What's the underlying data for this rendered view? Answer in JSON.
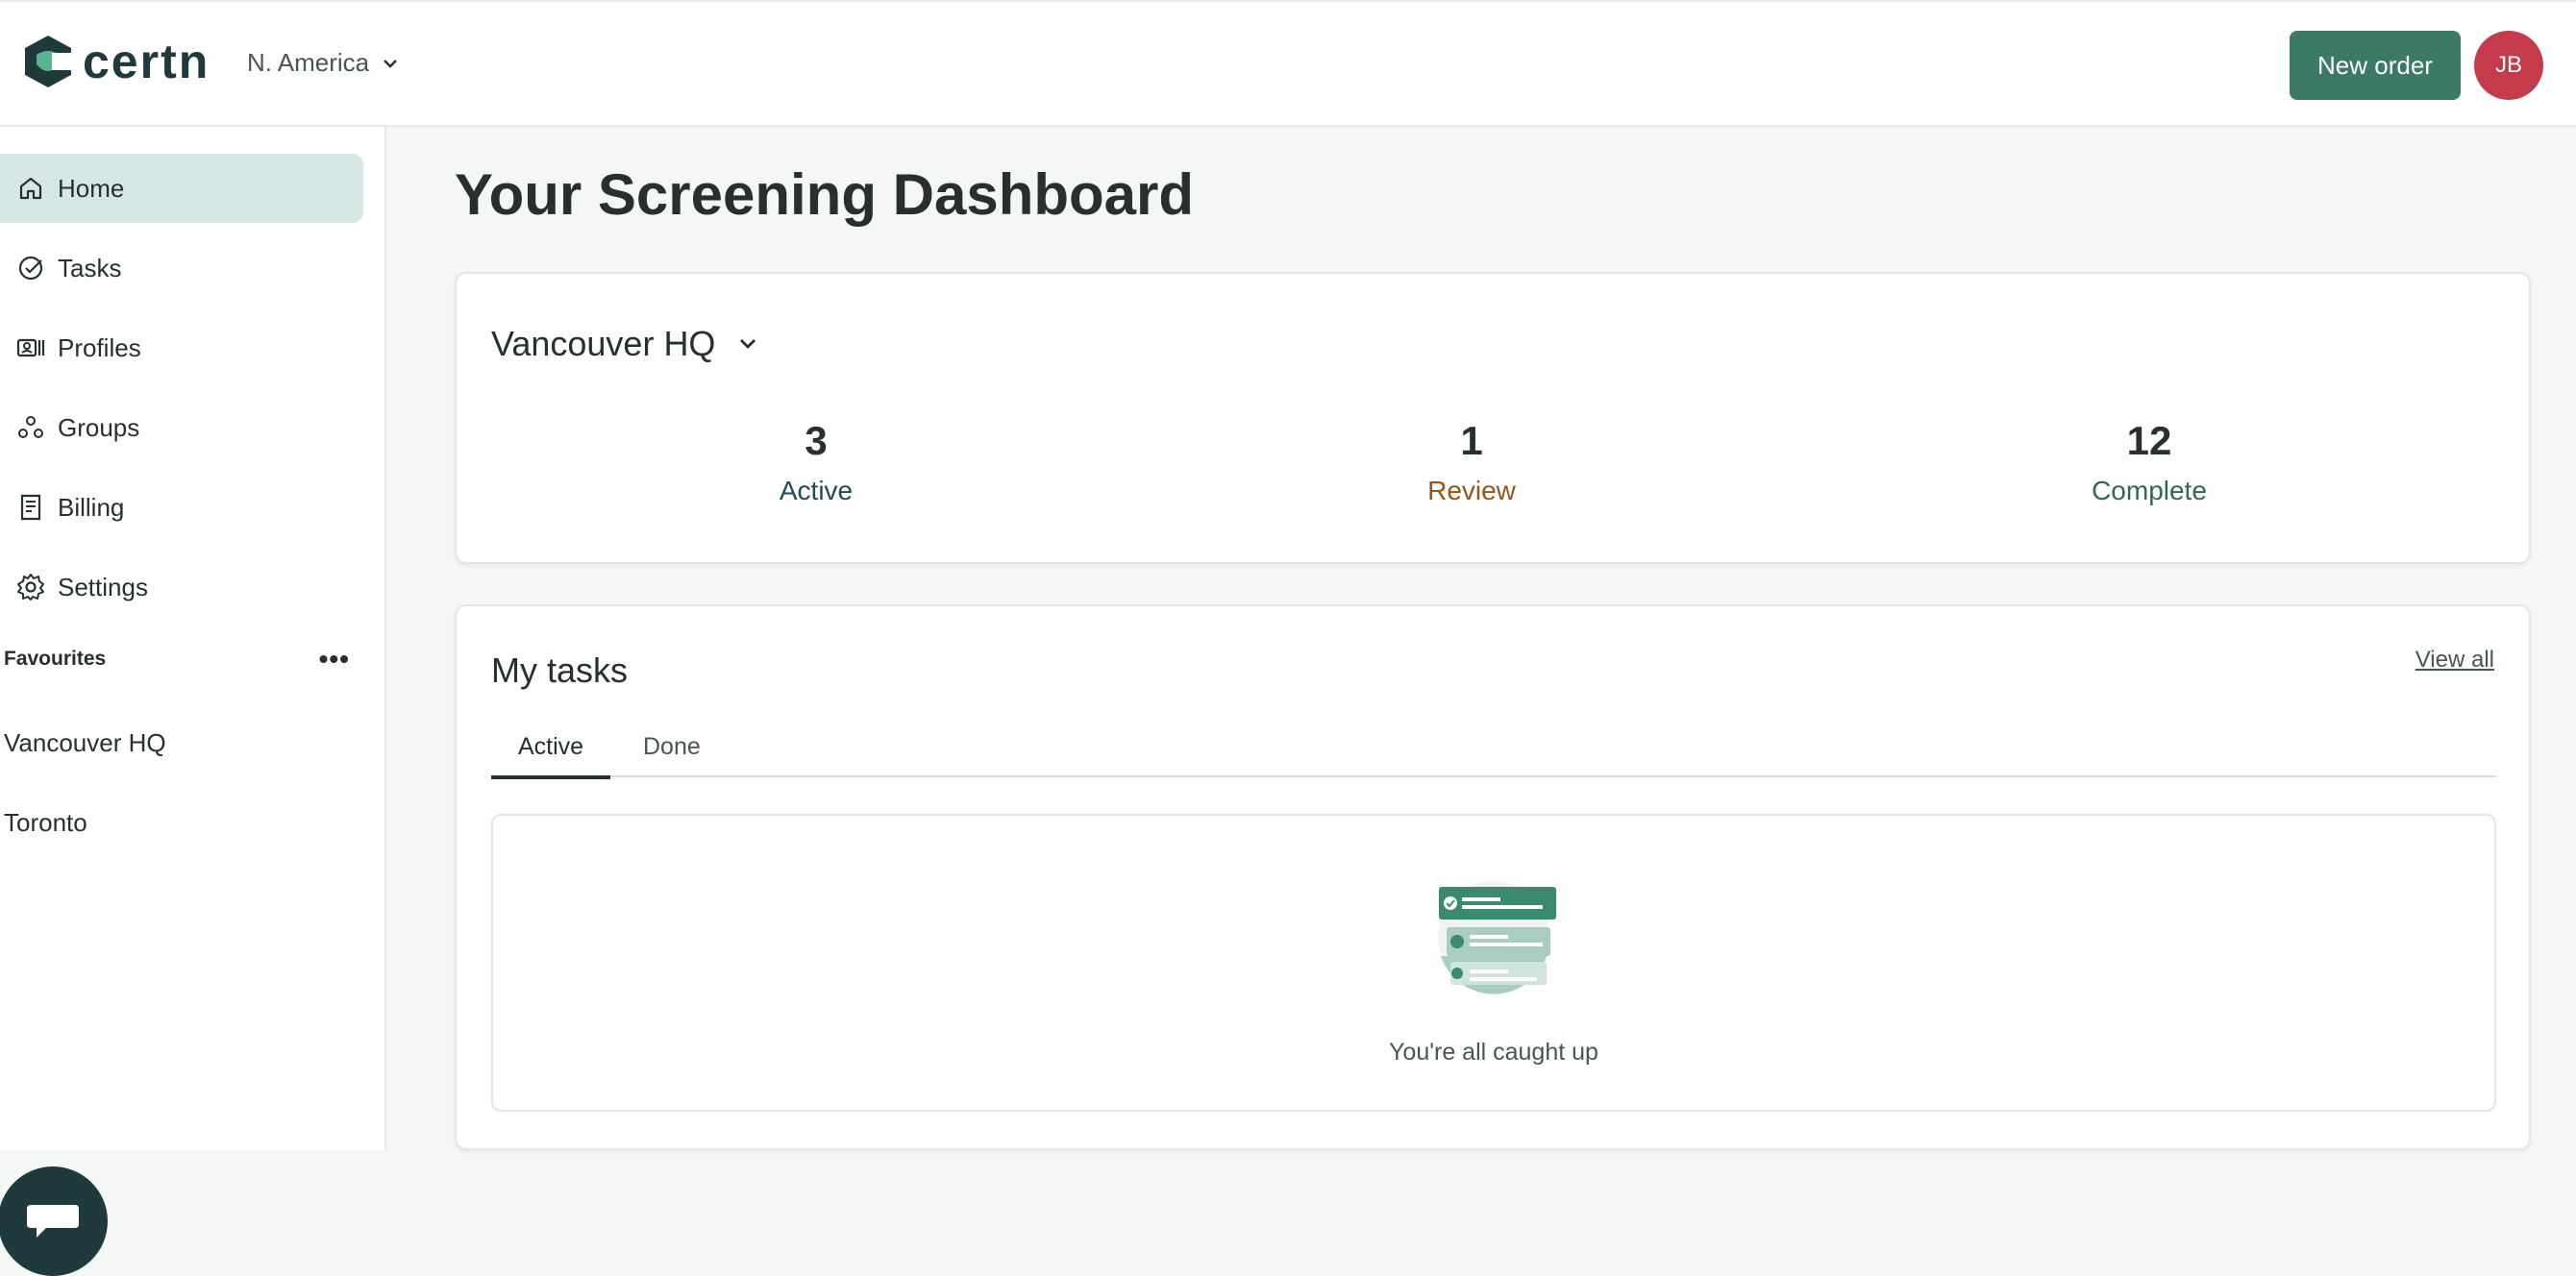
{
  "header": {
    "brand": "certn",
    "region": "N. America",
    "new_order_label": "New order",
    "avatar_initials": "JB",
    "colors": {
      "brand": "#1f3a3d",
      "accent": "#3a7a66",
      "avatar": "#c43c4c"
    }
  },
  "sidebar": {
    "items": [
      {
        "label": "Home",
        "icon": "home-icon"
      },
      {
        "label": "Tasks",
        "icon": "check-circle-icon"
      },
      {
        "label": "Profiles",
        "icon": "profile-card-icon"
      },
      {
        "label": "Groups",
        "icon": "groups-icon"
      },
      {
        "label": "Billing",
        "icon": "receipt-icon"
      },
      {
        "label": "Settings",
        "icon": "gear-icon"
      }
    ],
    "favourites_heading": "Favourites",
    "favourites_more": "•••",
    "favourites": [
      "Vancouver HQ",
      "Toronto"
    ]
  },
  "main": {
    "title": "Your Screening Dashboard",
    "summary": {
      "location": "Vancouver HQ",
      "stats": [
        {
          "value": "3",
          "label": "Active",
          "color": "#1f4b5a"
        },
        {
          "value": "1",
          "label": "Review",
          "color": "#9a5418"
        },
        {
          "value": "12",
          "label": "Complete",
          "color": "#2d6a4f"
        }
      ]
    },
    "tasks": {
      "title": "My tasks",
      "view_all": "View all",
      "tabs": [
        "Active",
        "Done"
      ],
      "empty_message": "You're all caught up"
    }
  }
}
